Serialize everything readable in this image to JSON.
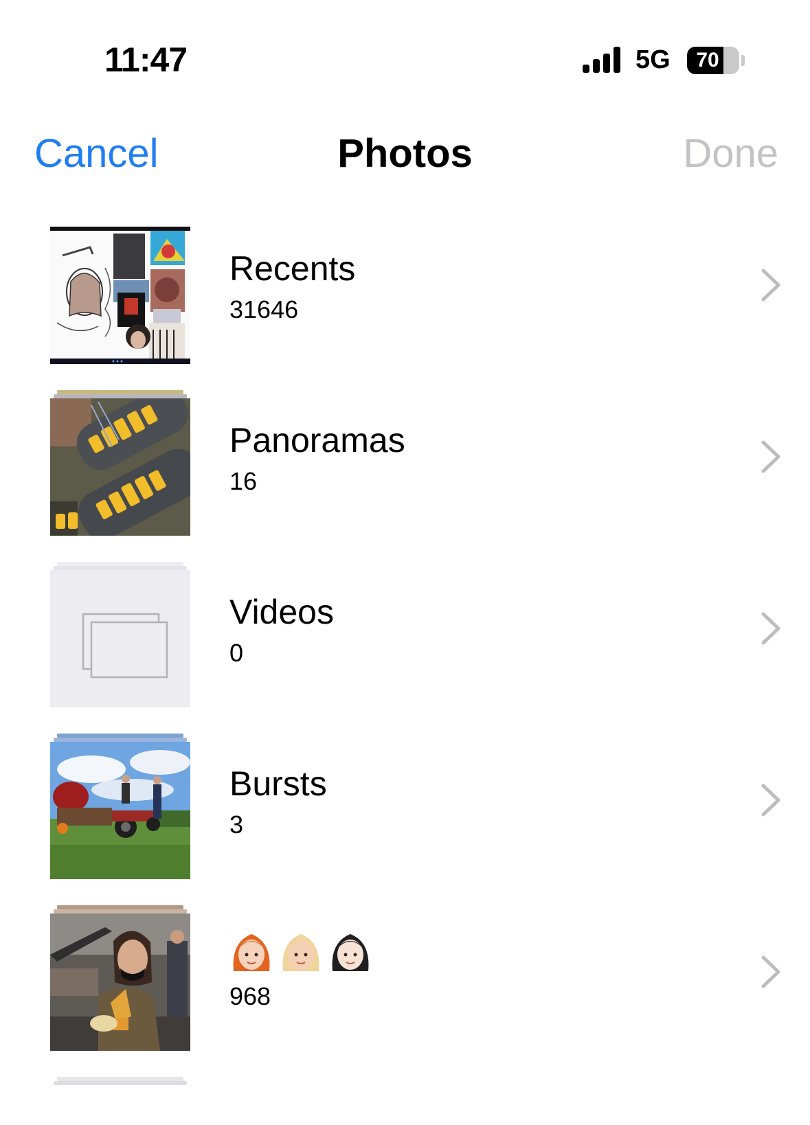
{
  "status_bar": {
    "time": "11:47",
    "network": "5G",
    "battery": "70",
    "battery_level": 0.7
  },
  "nav": {
    "cancel_label": "Cancel",
    "title": "Photos",
    "done_label": "Done"
  },
  "albums": [
    {
      "name": "Recents",
      "count": "31646",
      "thumbnail": "collage-thumbnail"
    },
    {
      "name": "Panoramas",
      "count": "16",
      "thumbnail": "shoes-thumbnail"
    },
    {
      "name": "Videos",
      "count": "0",
      "thumbnail": "empty-album-placeholder"
    },
    {
      "name": "Bursts",
      "count": "3",
      "thumbnail": "tractor-field-thumbnail"
    },
    {
      "name": "👩🏻‍🦰👱🏼‍♀️👩🏻",
      "count": "968",
      "thumbnail": "person-with-cone-thumbnail"
    }
  ],
  "colors": {
    "accent": "#1f7ef0",
    "disabled": "#c3c3c7"
  }
}
